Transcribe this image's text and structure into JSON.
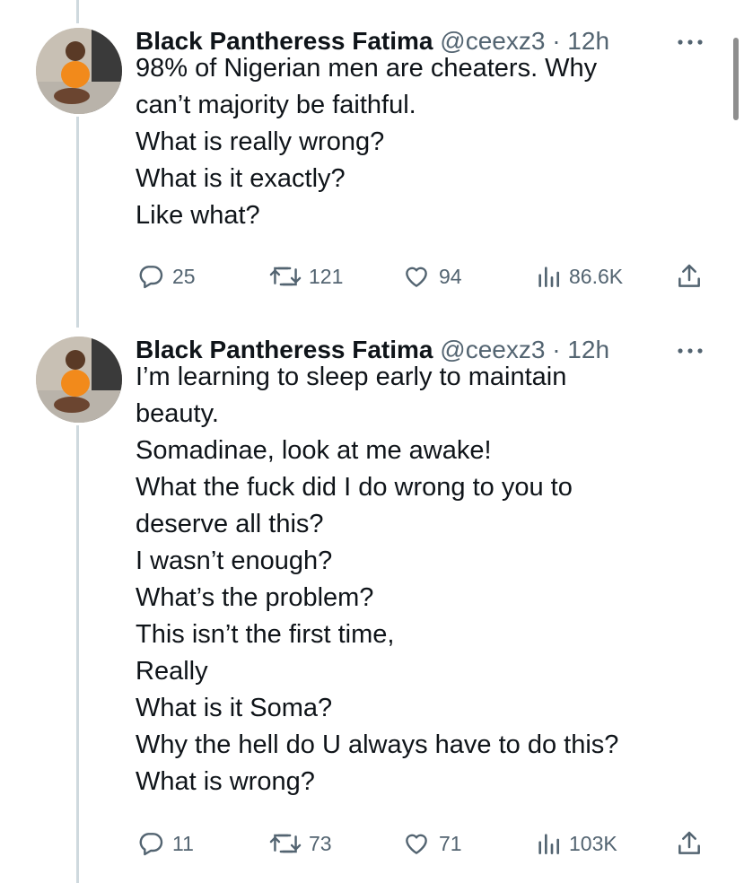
{
  "tweets": [
    {
      "name": "Black Pantheress Fatima",
      "handle": "@ceexz3",
      "time": "· 12h",
      "lines": [
        "98% of Nigerian men are cheaters. Why",
        "can’t majority be faithful.",
        "What is really wrong?",
        "What is it exactly?",
        "Like what?"
      ],
      "replies": "25",
      "retweets": "121",
      "likes": "94",
      "views": "86.6K"
    },
    {
      "name": "Black Pantheress Fatima",
      "handle": "@ceexz3",
      "time": "· 12h",
      "lines": [
        "I’m learning to sleep early to maintain",
        "beauty.",
        "Somadinae, look at me awake!",
        "What the fuck did I do wrong to you to",
        "deserve all this?",
        "I wasn’t enough?",
        "What’s the problem?",
        "This isn’t the first time,",
        "Really",
        "What is it Soma?",
        "Why the hell do U always have to do this?",
        "What is wrong?"
      ],
      "replies": "11",
      "retweets": "73",
      "likes": "71",
      "views": "103K"
    }
  ],
  "icons": [
    "reply-icon",
    "retweet-icon",
    "like-icon",
    "views-icon",
    "share-icon",
    "more-icon"
  ],
  "colors": {
    "text": "#0f1419",
    "secondary": "#536471",
    "thread_line": "#cfd9de"
  }
}
